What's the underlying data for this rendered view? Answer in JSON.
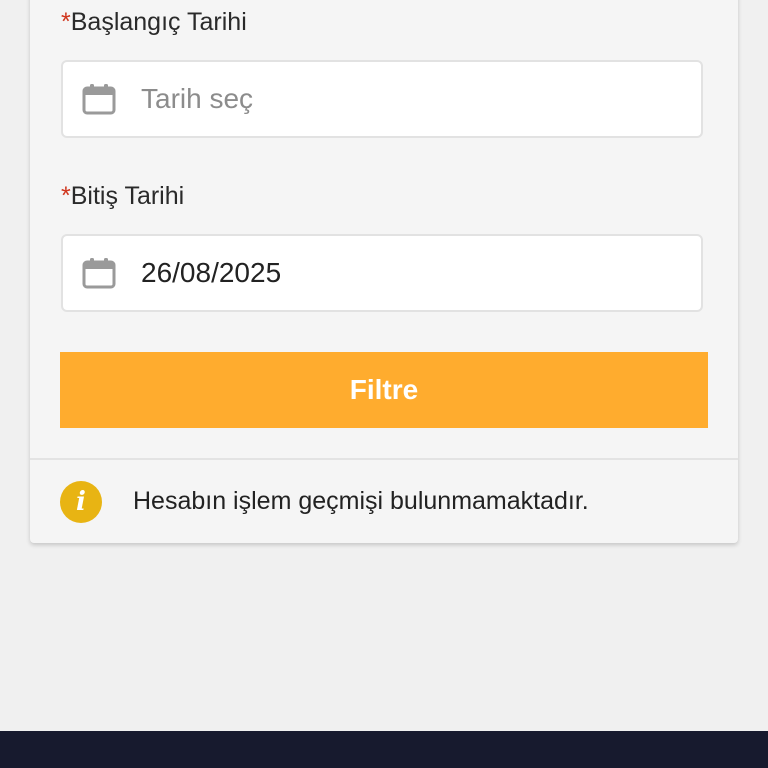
{
  "form": {
    "start_date": {
      "required_mark": "*",
      "label": "Başlangıç Tarihi",
      "placeholder": "Tarih seç",
      "value": ""
    },
    "end_date": {
      "required_mark": "*",
      "label": "Bitiş Tarihi",
      "placeholder": "",
      "value": "26/08/2025"
    },
    "filter_button_label": "Filtre"
  },
  "info": {
    "icon": "info-icon",
    "icon_glyph": "i",
    "message": "Hesabın işlem geçmişi bulunmamaktadır."
  },
  "colors": {
    "accent": "#ffac2e",
    "required": "#d0351d",
    "info_icon": "#e8b413",
    "bottom_bar": "#171a2e"
  }
}
